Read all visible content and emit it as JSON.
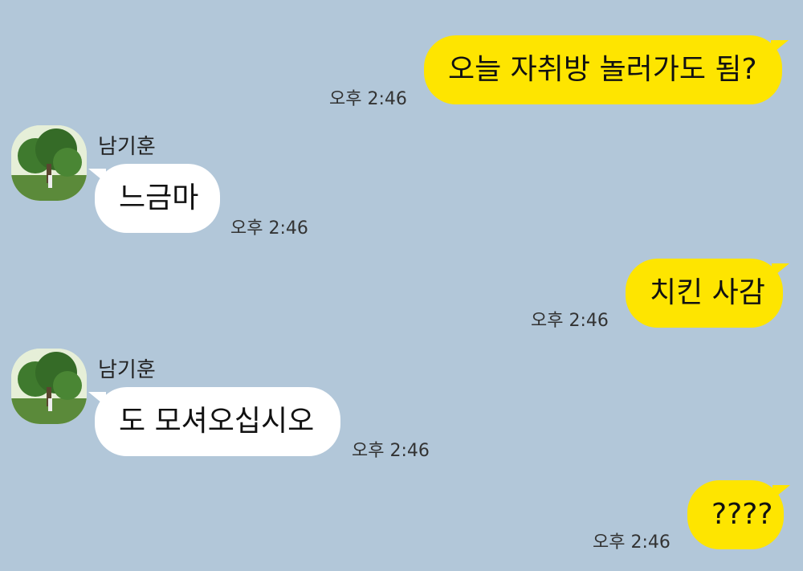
{
  "messages": [
    {
      "sender": "me",
      "text": "오늘 자취방 놀러가도 됨?",
      "time": "오후 2:46"
    },
    {
      "sender": "other",
      "name": "남기훈",
      "text": "느금마",
      "time": "오후 2:46"
    },
    {
      "sender": "me",
      "text": "치킨 사감",
      "time": "오후 2:46"
    },
    {
      "sender": "other",
      "name": "남기훈",
      "text": "도 모셔오십시오",
      "time": "오후 2:46"
    },
    {
      "sender": "me",
      "text": "????",
      "time": "오후 2:46"
    }
  ],
  "colors": {
    "background": "#b2c7d9",
    "my_bubble": "#fee500",
    "other_bubble": "#ffffff"
  },
  "icons": {
    "avatar": "profile-tree-photo-icon"
  }
}
